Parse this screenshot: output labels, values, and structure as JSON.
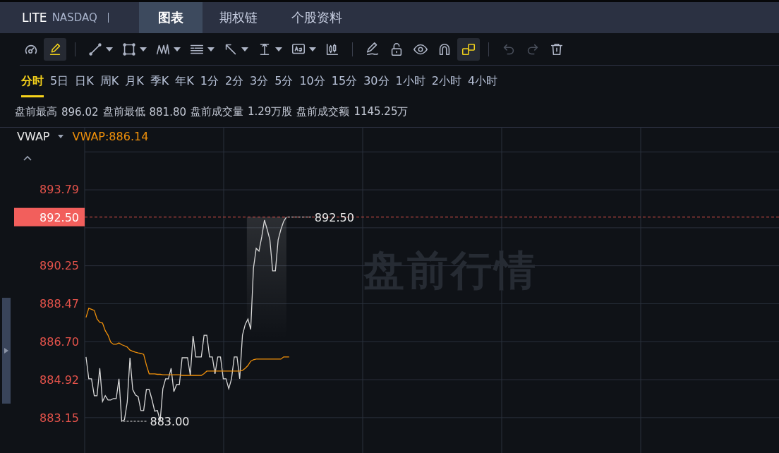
{
  "header": {
    "symbol": "LITE",
    "exchange": "NASDAQ",
    "tabs": [
      {
        "label": "图表",
        "selected": true
      },
      {
        "label": "期权链",
        "selected": false
      },
      {
        "label": "个股资料",
        "selected": false
      }
    ]
  },
  "toolbar": {
    "tools": [
      {
        "active": false,
        "disabled": false,
        "dropdown": false
      },
      {
        "active": true,
        "disabled": false,
        "dropdown": false
      },
      {
        "active": false,
        "disabled": false,
        "dropdown": true
      },
      {
        "active": false,
        "disabled": false,
        "dropdown": true
      },
      {
        "active": false,
        "disabled": false,
        "dropdown": true
      },
      {
        "active": false,
        "disabled": false,
        "dropdown": true
      },
      {
        "active": false,
        "disabled": false,
        "dropdown": true
      },
      {
        "active": false,
        "disabled": false,
        "dropdown": true
      },
      {
        "active": false,
        "disabled": false,
        "dropdown": true
      },
      {
        "active": false,
        "disabled": false,
        "dropdown": false
      },
      {
        "active": false,
        "disabled": false,
        "dropdown": false
      },
      {
        "active": false,
        "disabled": false,
        "dropdown": false
      },
      {
        "active": false,
        "disabled": false,
        "dropdown": false
      },
      {
        "active": false,
        "disabled": false,
        "dropdown": false
      },
      {
        "active": true,
        "disabled": false,
        "dropdown": false
      },
      {
        "active": false,
        "disabled": true,
        "dropdown": false
      },
      {
        "active": false,
        "disabled": true,
        "dropdown": false
      },
      {
        "active": false,
        "disabled": false,
        "dropdown": false
      }
    ]
  },
  "periods": [
    {
      "label": "分时",
      "selected": true
    },
    {
      "label": "5日",
      "selected": false
    },
    {
      "label": "日K",
      "selected": false
    },
    {
      "label": "周K",
      "selected": false
    },
    {
      "label": "月K",
      "selected": false
    },
    {
      "label": "季K",
      "selected": false
    },
    {
      "label": "年K",
      "selected": false
    },
    {
      "label": "1分",
      "selected": false
    },
    {
      "label": "2分",
      "selected": false
    },
    {
      "label": "3分",
      "selected": false
    },
    {
      "label": "5分",
      "selected": false
    },
    {
      "label": "10分",
      "selected": false
    },
    {
      "label": "15分",
      "selected": false
    },
    {
      "label": "30分",
      "selected": false
    },
    {
      "label": "1小时",
      "selected": false
    },
    {
      "label": "2小时",
      "selected": false
    },
    {
      "label": "4小时",
      "selected": false
    }
  ],
  "stats": [
    {
      "label": "盘前最高",
      "value": "896.02"
    },
    {
      "label": "盘前最低",
      "value": "881.80"
    },
    {
      "label": "盘前成交量",
      "value": "1.29万股"
    },
    {
      "label": "盘前成交额",
      "value": "1145.25万"
    }
  ],
  "legend": {
    "value": "VWAP:886.14"
  },
  "chart": {
    "overlay_text": "盘前行情",
    "chart_data": {
      "type": "line",
      "ylim": [
        881.5,
        896.7
      ],
      "grid": true,
      "yticks": [
        {
          "value": 893.79,
          "label": "893.79"
        },
        {
          "value": 890.25,
          "label": "890.25"
        },
        {
          "value": 888.47,
          "label": "888.47"
        },
        {
          "value": 886.7,
          "label": "886.70"
        },
        {
          "value": 884.92,
          "label": "884.92"
        },
        {
          "value": 883.15,
          "label": "883.15"
        }
      ],
      "categories": [
        null,
        null,
        null,
        null,
        null,
        null,
        null,
        null,
        null,
        null,
        null,
        null,
        null,
        null,
        null,
        null,
        null,
        null,
        null,
        null,
        null,
        null,
        null,
        null,
        null,
        null,
        null,
        null,
        null,
        null,
        null,
        null,
        null,
        null,
        null,
        null,
        null,
        null,
        null,
        null,
        null,
        null,
        null,
        null,
        null,
        null,
        null,
        null,
        null,
        null,
        null,
        null,
        null,
        null,
        null,
        null,
        null,
        null,
        null,
        null,
        null,
        null,
        null,
        null,
        null,
        null,
        null,
        null,
        null,
        null,
        null,
        null,
        null,
        null,
        null,
        null,
        null,
        null,
        null,
        null,
        null,
        null,
        null,
        null,
        null,
        null,
        null,
        null,
        null,
        null,
        null,
        null,
        null,
        null,
        null,
        null,
        null,
        null,
        null,
        null,
        null,
        null,
        null,
        null,
        null,
        null,
        null,
        null,
        null,
        null,
        null,
        null,
        null,
        null,
        null,
        null,
        null,
        null,
        null,
        null,
        null,
        null,
        null,
        null,
        null,
        null,
        null,
        null,
        null,
        null,
        null,
        null,
        null,
        null,
        null,
        null,
        null,
        null,
        null,
        null,
        null,
        null,
        null,
        null,
        null,
        null,
        null,
        null,
        null,
        null,
        null,
        null,
        null,
        null,
        null,
        null,
        null,
        null,
        null,
        null,
        null,
        null,
        null,
        null,
        null,
        null,
        null,
        null,
        null,
        null,
        null,
        null,
        null,
        null,
        null,
        null,
        null,
        null,
        null,
        null,
        null,
        null,
        null,
        null,
        null,
        null,
        null,
        null,
        null,
        null,
        null,
        null,
        null,
        null,
        null,
        null,
        null,
        null,
        null,
        null,
        null,
        null,
        null,
        null,
        null,
        null,
        null,
        null,
        null,
        null,
        null,
        null,
        null,
        null,
        null,
        null,
        null,
        null,
        null,
        null,
        null,
        null,
        null,
        null,
        null,
        null,
        null,
        null,
        null,
        null,
        null,
        null,
        null,
        null,
        null,
        null,
        null,
        null,
        null,
        null,
        null,
        null,
        null,
        null,
        null,
        null,
        null,
        null,
        null,
        null,
        null,
        null,
        null
      ],
      "series": [
        {
          "color": "#d9d9d9",
          "values": [
            885.98,
            884.96,
            884.96,
            884.17,
            884.17,
            885.45,
            883.9,
            884.17,
            883.97,
            883.97,
            884.04,
            884.04,
            884.96,
            882.98,
            883.05,
            883.87,
            885.94,
            884.46,
            884.2,
            884.13,
            883.48,
            883.48,
            884.46,
            884.46,
            884.0,
            883.45,
            883.48,
            883.0,
            884.5,
            884.96,
            884.96,
            885.45,
            884.36,
            884.69,
            884.69,
            885.94,
            885.94,
            885.94,
            885.12,
            886.96,
            885.98,
            885.98,
            885.98,
            886.99,
            886.99,
            885.98,
            885.98,
            885.19,
            885.98,
            885.98,
            884.96,
            884.96,
            884.5,
            884.96,
            885.98,
            885.98,
            884.96,
            886.99,
            887.49,
            887.75,
            887.26,
            890.12,
            891.04,
            890.91,
            891.57,
            892.36,
            891.93,
            891.44,
            889.99,
            889.99,
            891.44,
            891.93,
            892.3,
            892.5,
            null,
            null,
            null,
            null,
            null,
            null,
            null,
            null,
            null,
            null,
            null,
            null,
            null,
            null,
            null,
            null,
            null,
            null,
            null,
            null,
            null,
            null,
            null,
            null,
            null,
            null,
            null,
            null,
            null,
            null,
            null,
            null,
            null,
            null,
            null,
            null,
            null,
            null,
            null,
            null,
            null,
            null,
            null,
            null,
            null,
            null,
            null,
            null,
            null,
            null,
            null,
            null,
            null,
            null,
            null,
            null,
            null,
            null,
            null,
            null,
            null,
            null,
            null,
            null,
            null,
            null,
            null,
            null,
            null,
            null,
            null,
            null,
            null,
            null,
            null,
            null,
            null,
            null,
            null,
            null,
            null,
            null,
            null,
            null,
            null,
            null,
            null,
            null,
            null,
            null,
            null,
            null,
            null,
            null,
            null,
            null,
            null,
            null,
            null,
            null,
            null,
            null,
            null,
            null,
            null,
            null,
            null,
            null,
            null,
            null,
            null,
            null,
            null,
            null,
            null,
            null,
            null,
            null,
            null,
            null,
            null,
            null,
            null,
            null,
            null,
            null,
            null,
            null,
            null,
            null,
            null,
            null,
            null,
            null,
            null,
            null,
            null,
            null,
            null,
            null,
            null,
            null,
            null,
            null,
            null,
            null,
            null,
            null,
            null,
            null,
            null,
            null,
            null,
            null,
            null,
            null,
            null,
            null,
            null,
            null,
            null,
            null,
            null,
            null,
            null,
            null,
            null,
            null,
            null,
            null,
            null,
            null,
            null,
            null,
            null,
            null,
            null,
            null,
            null
          ]
        },
        {
          "name": "VWAP",
          "color": "#f0900a",
          "values": [
            887.82,
            888.25,
            888.2,
            888.15,
            887.75,
            887.59,
            887.56,
            887.2,
            886.99,
            886.67,
            886.57,
            886.57,
            886.63,
            886.55,
            886.5,
            886.44,
            886.3,
            886.24,
            886.2,
            886.17,
            886.14,
            886.1,
            885.6,
            885.19,
            885.19,
            885.19,
            885.17,
            885.17,
            885.15,
            885.15,
            885.15,
            885.15,
            885.15,
            885.15,
            885.15,
            885.12,
            885.12,
            885.12,
            885.12,
            885.12,
            885.12,
            885.12,
            885.12,
            885.2,
            885.32,
            885.32,
            885.32,
            885.32,
            885.32,
            885.32,
            885.32,
            885.32,
            885.32,
            885.32,
            885.32,
            885.32,
            885.32,
            885.35,
            885.45,
            885.58,
            885.78,
            885.85,
            885.88,
            885.88,
            885.88,
            885.88,
            885.88,
            885.88,
            885.88,
            885.88,
            885.88,
            885.88,
            885.98,
            885.98,
            885.98,
            null,
            null,
            null,
            null,
            null,
            null,
            null,
            null,
            null,
            null,
            null,
            null,
            null,
            null,
            null,
            null,
            null,
            null,
            null,
            null,
            null,
            null,
            null,
            null,
            null,
            null,
            null,
            null,
            null,
            null,
            null,
            null,
            null,
            null,
            null,
            null,
            null,
            null,
            null,
            null,
            null,
            null,
            null,
            null,
            null,
            null,
            null,
            null,
            null,
            null,
            null,
            null,
            null,
            null,
            null,
            null,
            null,
            null,
            null,
            null,
            null,
            null,
            null,
            null,
            null,
            null,
            null,
            null,
            null,
            null,
            null,
            null,
            null,
            null,
            null,
            null,
            null,
            null,
            null,
            null,
            null,
            null,
            null,
            null,
            null,
            null,
            null,
            null,
            null,
            null,
            null,
            null,
            null,
            null,
            null,
            null,
            null,
            null,
            null,
            null,
            null,
            null,
            null,
            null,
            null,
            null,
            null,
            null,
            null,
            null,
            null,
            null,
            null,
            null,
            null,
            null,
            null,
            null,
            null,
            null,
            null,
            null,
            null,
            null,
            null,
            null,
            null,
            null,
            null,
            null,
            null,
            null,
            null,
            null,
            null,
            null,
            null,
            null,
            null,
            null,
            null,
            null,
            null,
            null,
            null,
            null,
            null,
            null,
            null,
            null,
            null,
            null,
            null,
            null,
            null,
            null,
            null,
            null,
            null,
            null,
            null,
            null,
            null,
            null,
            null,
            null,
            null,
            null,
            null,
            null,
            null,
            null,
            null,
            null,
            null,
            null,
            null,
            null
          ]
        }
      ],
      "ref_lines": [
        {
          "axis": "y",
          "value": 892.5,
          "label": "892.50",
          "color": "#e5534b"
        }
      ],
      "annotations": [
        "892.50",
        "883.00"
      ]
    }
  }
}
